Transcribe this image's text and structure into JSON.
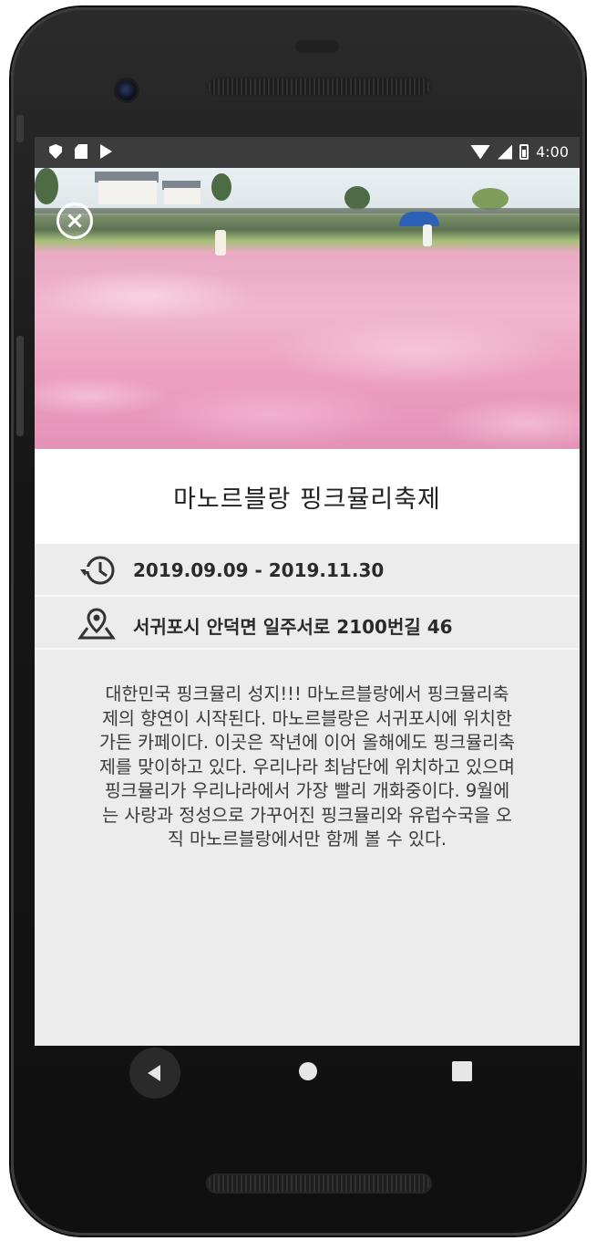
{
  "status_bar": {
    "time": "4:00",
    "left_icons": [
      "shield-icon",
      "sim-card-icon",
      "play-store-icon"
    ],
    "right_icons": [
      "wifi-icon",
      "signal-icon",
      "battery-icon"
    ]
  },
  "hero": {
    "close_icon": "close-circle-icon",
    "close_glyph": "×"
  },
  "event": {
    "title": "마노르블랑 핑크뮬리축제",
    "date_range": "2019.09.09 - 2019.11.30",
    "address": "서귀포시 안덕면 일주서로 2100번길 46",
    "description_lines": [
      "대한민국 핑크뮬리 성지!!! 마노르블랑에서 핑크뮬리축",
      "제의 향연이 시작된다. 마노르블랑은 서귀포시에 위치한",
      "가든 카페이다. 이곳은 작년에 이어 올해에도 핑크뮬리축",
      "제를 맞이하고 있다. 우리나라 최남단에 위치하고 있으며",
      "핑크뮬리가 우리나라에서 가장 빨리 개화중이다. 9월에",
      "는 사랑과 정성으로 가꾸어진 핑크뮬리와 유럽수국을 오",
      "직 마노르블랑에서만 함께 볼 수 있다."
    ]
  },
  "icons": {
    "date": "history-clock-icon",
    "address": "map-location-icon"
  },
  "nav_bar": {
    "buttons": [
      "back-button",
      "home-button",
      "recents-button"
    ]
  },
  "colors": {
    "screen_bg": "#ececec",
    "status_bar": "#3c3c3c",
    "title_bg": "#ffffff",
    "accent_pink": "#f1b7cd"
  }
}
